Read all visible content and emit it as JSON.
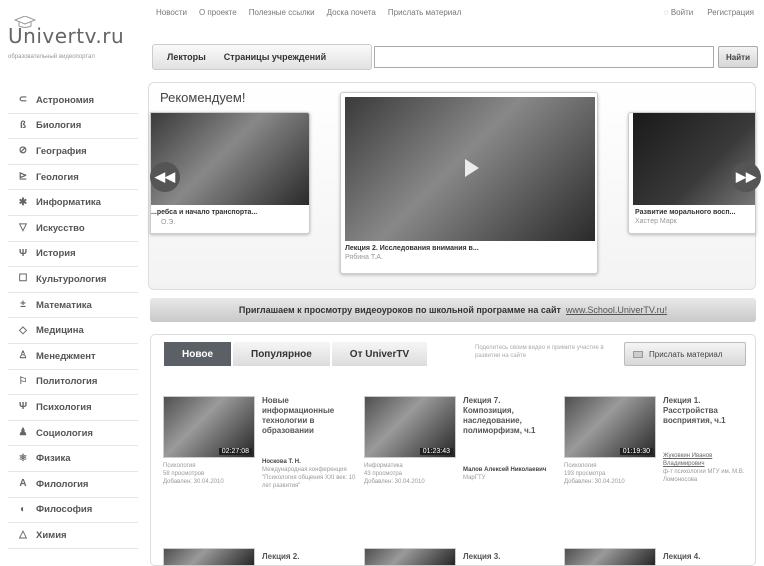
{
  "logo": {
    "name": "Univertv.ru",
    "tagline": "образовательный видеопортал"
  },
  "topnav": [
    "Новости",
    "О проекте",
    "Полезные ссылки",
    "Доска почета",
    "Прислать материал"
  ],
  "auth": {
    "login": "Войти",
    "register": "Регистрация"
  },
  "header_tabs": [
    "Лекторы",
    "Страницы учреждений"
  ],
  "search": {
    "value": "",
    "button": "Найти"
  },
  "sidebar": [
    {
      "label": "Астрономия",
      "icon": "telescope-icon",
      "glyph": "⊂"
    },
    {
      "label": "Биология",
      "icon": "microscope-icon",
      "glyph": "ß"
    },
    {
      "label": "География",
      "icon": "globe-icon",
      "glyph": "⊘"
    },
    {
      "label": "Геология",
      "icon": "rock-icon",
      "glyph": "⊵"
    },
    {
      "label": "Информатика",
      "icon": "chip-icon",
      "glyph": "✱"
    },
    {
      "label": "Искусство",
      "icon": "easel-icon",
      "glyph": "▽"
    },
    {
      "label": "История",
      "icon": "column-icon",
      "glyph": "Ψ"
    },
    {
      "label": "Культурология",
      "icon": "frame-icon",
      "glyph": "☐"
    },
    {
      "label": "Математика",
      "icon": "math-icon",
      "glyph": "±"
    },
    {
      "label": "Медицина",
      "icon": "medicine-icon",
      "glyph": "◇"
    },
    {
      "label": "Менеджмент",
      "icon": "person-icon",
      "glyph": "♙"
    },
    {
      "label": "Политология",
      "icon": "flag-icon",
      "glyph": "⚐"
    },
    {
      "label": "Психология",
      "icon": "psi-icon",
      "glyph": "Ψ"
    },
    {
      "label": "Социология",
      "icon": "group-icon",
      "glyph": "♟"
    },
    {
      "label": "Физика",
      "icon": "atom-icon",
      "glyph": "⚛"
    },
    {
      "label": "Филология",
      "icon": "letter-icon",
      "glyph": "A"
    },
    {
      "label": "Философия",
      "icon": "thought-icon",
      "glyph": "◐"
    },
    {
      "label": "Химия",
      "icon": "flask-icon",
      "glyph": "△"
    }
  ],
  "recommend": {
    "title": "Рекомендуем!",
    "cards": [
      {
        "title": "...ребса и начало транспорта...",
        "sub": "О.Э."
      },
      {
        "title": "Лекция 2. Исследования внимания в...",
        "sub": "Рябина Т.А."
      },
      {
        "title": "Развитие морального восп...",
        "sub": "Хастер Марк"
      }
    ]
  },
  "banner": {
    "text": "Приглашаем к просмотру видеоуроков по школьной программе на сайт",
    "link": "www.School.UniverTV.ru!"
  },
  "lower": {
    "tabs": [
      "Новое",
      "Популярное",
      "От UniverTV"
    ],
    "hint": "Поделитесь своим видео и примите участие в развитии на сайте",
    "send_button": "Прислать материал",
    "videos": [
      {
        "duration": "02:27:08",
        "title": "Новые информационные технологии в образовании",
        "author": "Носкова Т. Н.",
        "author_extra": "Международная конференция \"Психология общения XXI век: 10 лет развития\"",
        "category": "Психология",
        "views": "58 просмотров",
        "added": "Добавлен: 30.04.2010"
      },
      {
        "duration": "01:23:43",
        "title": "Лекция 7. Композиция, наследование, полиморфизм, ч.1",
        "author": "Малов Алексей Николаевич",
        "author_extra": "МарГТУ",
        "category": "Информатика",
        "views": "43 просмотра",
        "added": "Добавлен: 30.04.2010"
      },
      {
        "duration": "01:19:30",
        "title": "Лекция 1. Расстройства восприятия, ч.1",
        "author": "Жуковкин Иванов Владимирович",
        "author_extra": "ф-т психологии МГУ им. М.В. Ломоносова",
        "category": "Психология",
        "views": "193 просмотра",
        "added": "Добавлен: 30.04.2010"
      }
    ],
    "more_titles": [
      "Лекция 2.",
      "Лекция 3.",
      "Лекция 4."
    ]
  }
}
